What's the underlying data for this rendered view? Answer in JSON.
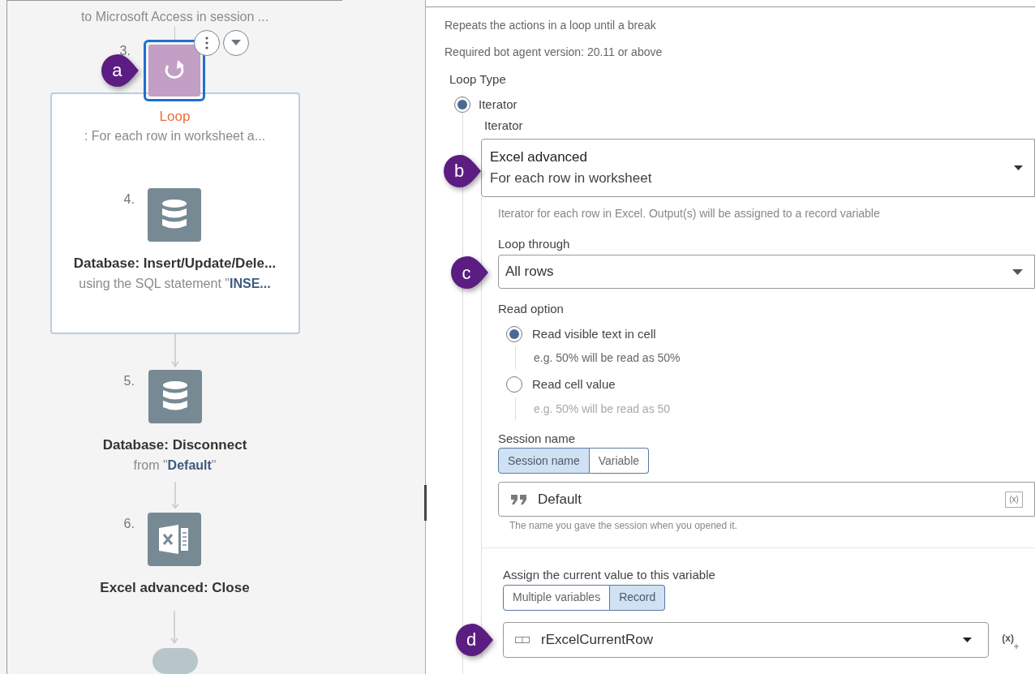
{
  "flow": {
    "previous_step_text": "to Microsoft Access in session ...",
    "steps": [
      {
        "number": "3.",
        "kind": "loop",
        "title": "Loop",
        "subtitle": ": For each row in worksheet a...",
        "selected": true,
        "callout": "a",
        "children": [
          {
            "number": "4.",
            "kind": "database",
            "title": "Database: Insert/Update/Dele...",
            "subtitle": "using the SQL statement \"**INSE...**",
            "selected": false
          }
        ]
      },
      {
        "number": "5.",
        "kind": "database",
        "title": "Database: Disconnect",
        "subtitle": "from \"**Default**\"",
        "selected": false
      },
      {
        "number": "6.",
        "kind": "excel",
        "title": "Excel advanced: Close",
        "selected": false
      }
    ]
  },
  "properties": {
    "description": "Repeats the actions in a loop until a break",
    "requirement": "Required bot agent version: 20.11 or above",
    "loop_type": {
      "label": "Loop Type",
      "options": [
        {
          "label": "Iterator",
          "selected": true
        }
      ]
    },
    "iterator": {
      "label": "Iterator",
      "package": "Excel advanced",
      "value": "For each row in worksheet",
      "callout": "b",
      "help": "Iterator for each row in Excel. Output(s) will be assigned to a record variable"
    },
    "loop_through": {
      "label": "Loop through",
      "value": "All rows",
      "callout": "c"
    },
    "read_option": {
      "label": "Read option",
      "options": [
        {
          "label": "Read visible text in cell",
          "example": "e.g. 50% will be read as 50%",
          "selected": true
        },
        {
          "label": "Read cell value",
          "example": "e.g. 50% will be read as 50",
          "selected": false
        }
      ]
    },
    "session_name": {
      "label": "Session name",
      "modes": [
        {
          "label": "Session name",
          "selected": true
        },
        {
          "label": "Variable",
          "selected": false
        }
      ],
      "value": "Default",
      "variable_button": "(x)",
      "help": "The name you gave the session when you opened it."
    },
    "assign": {
      "label": "Assign the current value to this variable",
      "modes": [
        {
          "label": "Multiple variables",
          "selected": false
        },
        {
          "label": "Record",
          "selected": true
        }
      ],
      "value": "rExcelCurrentRow",
      "variable_button": "(x)",
      "callout": "d"
    }
  }
}
